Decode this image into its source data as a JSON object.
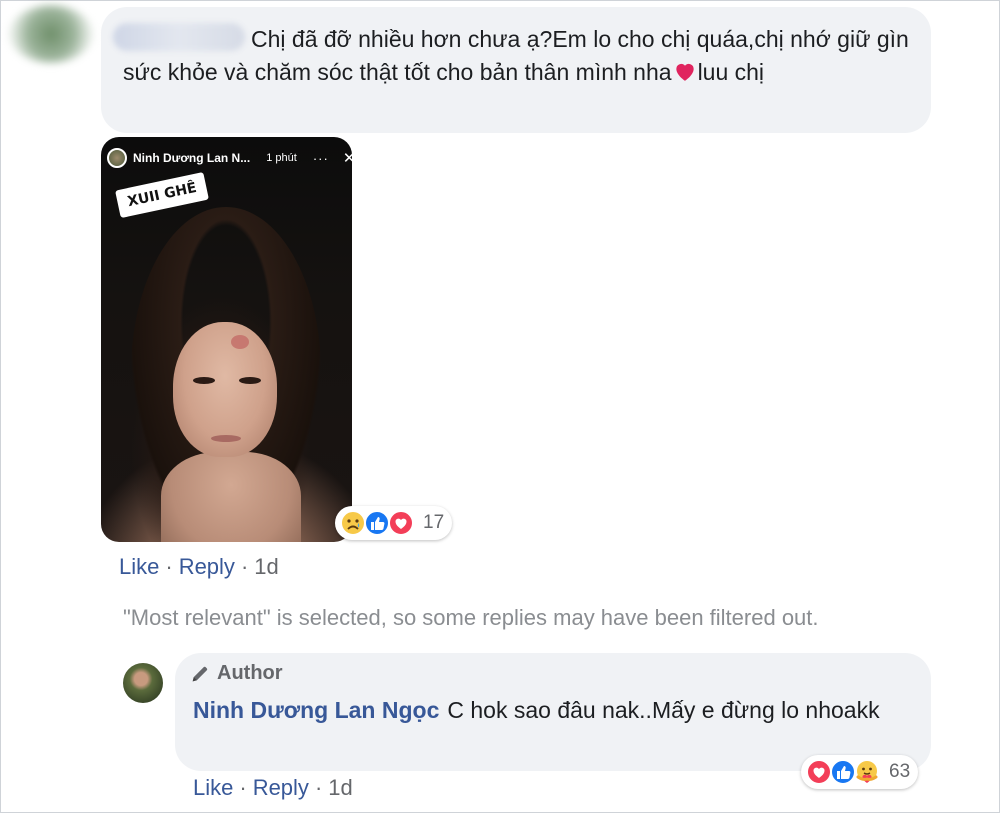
{
  "comment1": {
    "text": "Chị đã đỡ nhiều hơn chưa ạ?Em lo cho chị quáa,chị nhớ giữ gìn sức khỏe và chăm sóc thật tốt cho bản thân mình nha",
    "text_after": "luu chị",
    "attachment": {
      "story_name": "Ninh Dương Lan N...",
      "story_time": "1 phút",
      "story_more": "···",
      "story_close": "✕",
      "sticker": "XUII GHÊ"
    },
    "reactions": {
      "icons": [
        "sad-icon",
        "like-icon",
        "love-icon"
      ],
      "count": "17"
    },
    "actions": {
      "like": "Like",
      "reply": "Reply",
      "time": "1d",
      "separator": "·"
    }
  },
  "notice": "\"Most relevant\" is selected, so some replies may have been filtered out.",
  "reply": {
    "badge": "Author",
    "name": "Ninh Dương Lan Ngọc",
    "text": "C hok sao đâu nak..Mấy e đừng lo nhoakk",
    "reactions": {
      "icons": [
        "love-icon",
        "like-icon",
        "care-icon"
      ],
      "count": "63"
    },
    "actions": {
      "like": "Like",
      "reply": "Reply",
      "time": "1d",
      "separator": "·"
    }
  },
  "colors": {
    "link": "#385898",
    "bubble": "#f0f2f5",
    "muted": "#65676b",
    "notice": "#8a8d91"
  }
}
